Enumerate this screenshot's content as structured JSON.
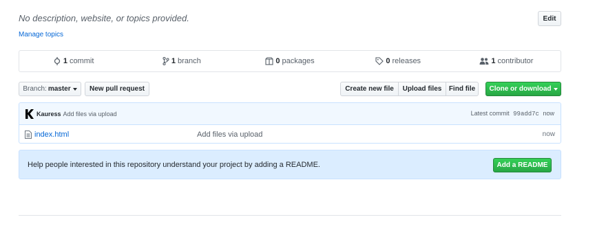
{
  "repo_meta": {
    "description": "No description, website, or topics provided.",
    "manage_topics": "Manage topics",
    "edit_label": "Edit"
  },
  "numbers_summary": [
    {
      "icon": "commit-icon",
      "count": "1",
      "label": "commit"
    },
    {
      "icon": "branch-icon",
      "count": "1",
      "label": "branch"
    },
    {
      "icon": "package-icon",
      "count": "0",
      "label": "packages"
    },
    {
      "icon": "tag-icon",
      "count": "0",
      "label": "releases"
    },
    {
      "icon": "people-icon",
      "count": "1",
      "label": "contributor"
    }
  ],
  "toolbar": {
    "branch_label": "Branch:",
    "branch_value": "master",
    "new_pr": "New pull request",
    "create_file": "Create new file",
    "upload_files": "Upload files",
    "find_file": "Find file",
    "clone": "Clone or download"
  },
  "commit": {
    "avatar_letter": "K",
    "author": "Kauress",
    "message": "Add files via upload",
    "latest_label": "Latest commit",
    "sha": "99add7c",
    "age": "now"
  },
  "files": [
    {
      "name": "index.html",
      "message": "Add files via upload",
      "age": "now"
    }
  ],
  "readme": {
    "text": "Help people interested in this repository understand your project by adding a README.",
    "button": "Add a README"
  },
  "colors": {
    "link": "#0366d6",
    "green": "#28a745",
    "readme_bg": "#dbedff",
    "commit_bg": "#f1f8ff"
  }
}
